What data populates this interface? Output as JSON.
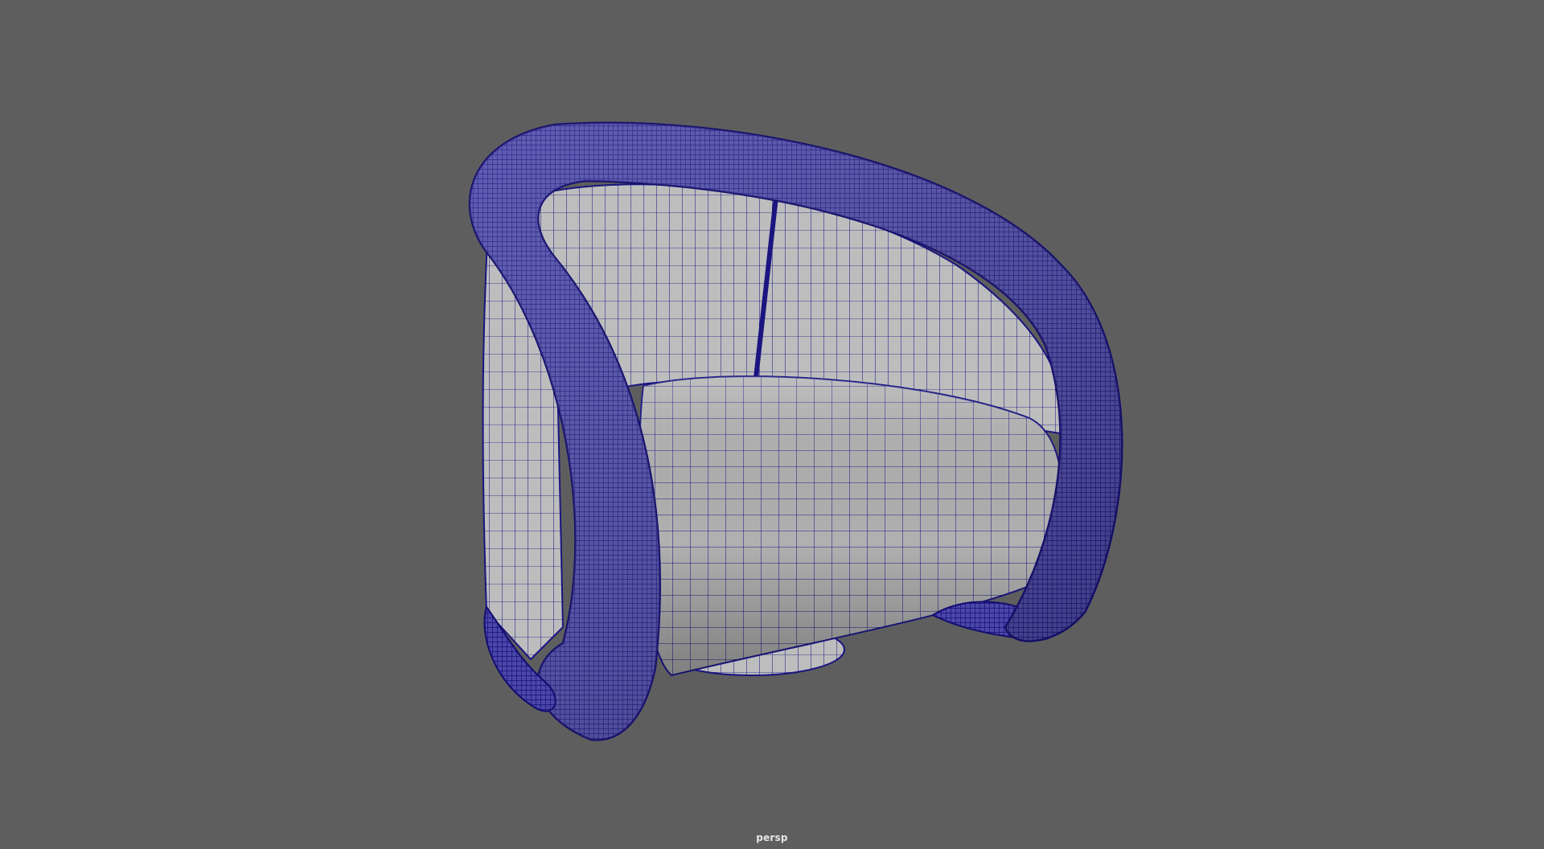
{
  "viewport": {
    "camera_name": "persp",
    "background_color": "#5e5e5e",
    "wireframe_color": "#1a1580",
    "shaded_color": "#b4b4b4"
  },
  "model": {
    "object": "armchair-wireframe-on-shaded",
    "parts": [
      "outer-tube-frame",
      "backrest-shell",
      "seat-cushion",
      "base-disc"
    ]
  }
}
